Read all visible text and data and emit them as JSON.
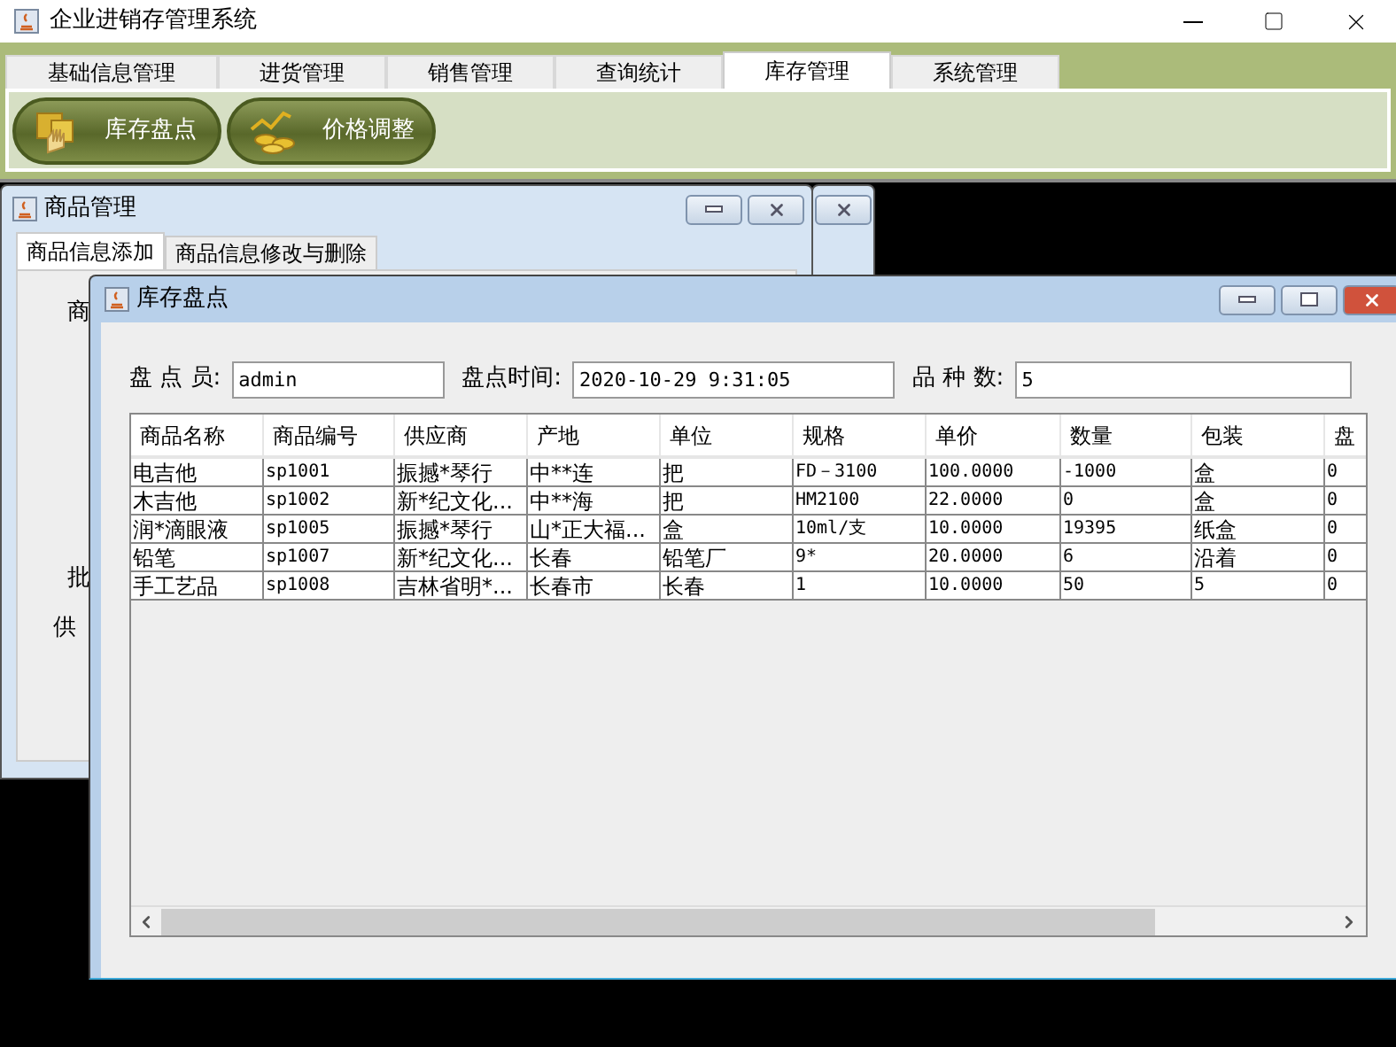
{
  "window": {
    "title": "企业进销存管理系统"
  },
  "menu_tabs": [
    {
      "label": "基础信息管理",
      "selected": false
    },
    {
      "label": "进货管理",
      "selected": false
    },
    {
      "label": "销售管理",
      "selected": false
    },
    {
      "label": "查询统计",
      "selected": false
    },
    {
      "label": "库存管理",
      "selected": true
    },
    {
      "label": "系统管理",
      "selected": false
    }
  ],
  "toolbar": [
    {
      "label": "库存盘点",
      "kind": "boxes"
    },
    {
      "label": "价格调整",
      "kind": "coins"
    }
  ],
  "product_window": {
    "title": "商品管理",
    "tabs": [
      {
        "label": "商品信息添加",
        "selected": true
      },
      {
        "label": "商品信息修改与删除",
        "selected": false
      }
    ],
    "labels": [
      "商",
      "批",
      "供"
    ]
  },
  "stock_window": {
    "title": "库存盘点",
    "fields": [
      {
        "label": "盘 点 员:",
        "value": "admin"
      },
      {
        "label": "盘点时间:",
        "value": "2020-10-29 9:31:05"
      },
      {
        "label": "品 种 数:",
        "value": "5"
      }
    ],
    "table": {
      "columns": [
        "商品名称",
        "商品编号",
        "供应商",
        "产地",
        "单位",
        "规格",
        "单价",
        "数量",
        "包装",
        "盘"
      ],
      "rows": [
        [
          "电吉他",
          "sp1001",
          "振撼*琴行",
          "中**连",
          "把",
          "FD－3100",
          "100.0000",
          "-1000",
          "盒",
          "0"
        ],
        [
          "木吉他",
          "sp1002",
          "新*纪文化...",
          "中**海",
          "把",
          "HM2100",
          "22.0000",
          "0",
          "盒",
          "0"
        ],
        [
          "润*滴眼液",
          "sp1005",
          "振撼*琴行",
          "山*正大福...",
          "盒",
          "10ml/支",
          "10.0000",
          "19395",
          "纸盒",
          "0"
        ],
        [
          "铅笔",
          "sp1007",
          "新*纪文化...",
          "长春",
          "铅笔厂",
          "9*",
          "20.0000",
          "6",
          "沿着",
          "0"
        ],
        [
          "手工艺品",
          "sp1008",
          "吉林省明*...",
          "长春市",
          "长春",
          "1",
          "10.0000",
          "50",
          "5",
          "0"
        ]
      ]
    }
  }
}
